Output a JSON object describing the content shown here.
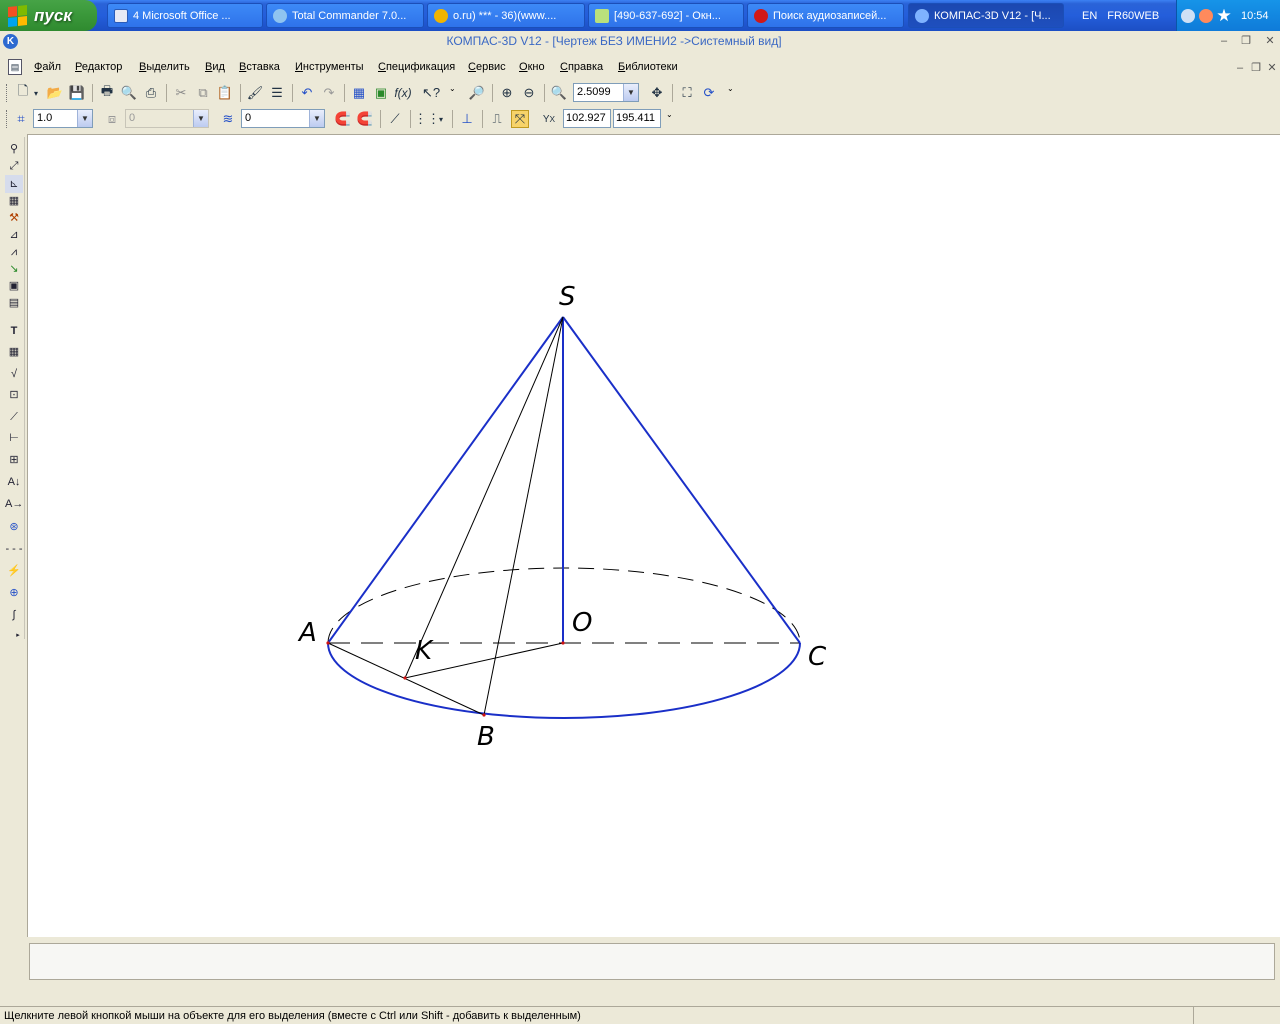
{
  "taskbar": {
    "start_label": "пуск",
    "tasks": [
      {
        "label": "4 Microsoft Office ...",
        "icon": "word-icon"
      },
      {
        "label": "Total Commander 7.0...",
        "icon": "total-commander-icon"
      },
      {
        "label": "o.ru) *** - 36)(www....",
        "icon": "browser-icon"
      },
      {
        "label": "[490-637-692] - Окн...",
        "icon": "icq-icon"
      },
      {
        "label": "Поиск аудиозаписей...",
        "icon": "opera-icon"
      },
      {
        "label": "КОМПАС-3D V12 - [Ч...",
        "icon": "kompas-icon"
      }
    ],
    "tray": {
      "lang": "EN",
      "user": "FR60WEB",
      "time": "10:54"
    }
  },
  "window": {
    "title": "КОМПАС-3D V12 - [Чертеж БЕЗ ИМЕНИ2 ->Системный вид]"
  },
  "menu": [
    "Файл",
    "Редактор",
    "Выделить",
    "Вид",
    "Вставка",
    "Инструменты",
    "Спецификация",
    "Сервис",
    "Окно",
    "Справка",
    "Библиотеки"
  ],
  "toolbar": {
    "zoom": "2.5099",
    "step": "1.0",
    "layer_disabled": "0",
    "style": "0",
    "coord_x": "102.927",
    "coord_y": "195.411"
  },
  "drawing": {
    "labels": {
      "S": "S",
      "O": "O",
      "A": "A",
      "K": "K",
      "B": "B",
      "C": "C"
    },
    "colors": {
      "outline": "#1a2fc8",
      "line": "#000000",
      "point": "#d01010"
    }
  },
  "status": {
    "hint": "Щелкните левой кнопкой мыши на объекте для его выделения (вместе с Ctrl или Shift - добавить к выделенным)"
  }
}
